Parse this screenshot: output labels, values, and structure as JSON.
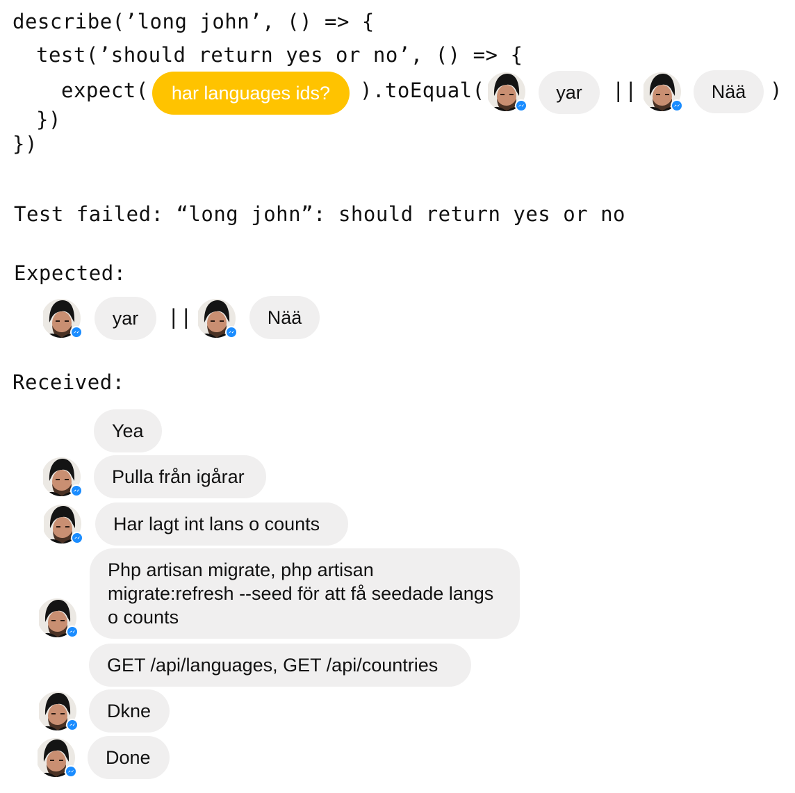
{
  "code": {
    "describe_line": "describe(’long john’, () => {",
    "test_line": "test(’should return yes or no’, () => {",
    "expect_open": "expect(",
    "to_equal": ").toEqual(",
    "or_op": "||",
    "close_paren": ")",
    "close_test": "})",
    "close_describe": "})"
  },
  "expect_bubble": "har languages ids?",
  "expected_values": [
    "yar",
    "Nää"
  ],
  "result": {
    "failure_line": "Test failed: “long john”: should return yes or no",
    "expected_label": "Expected:",
    "received_label": "Received:"
  },
  "received_messages": [
    "Yea",
    "Pulla från igårar",
    "Har lagt int lans o counts",
    "Php artisan migrate, php artisan migrate:refresh --seed för att få seedade langs o counts",
    "GET /api/languages, GET /api/countries",
    "Dkne",
    "Done"
  ],
  "icons": {
    "avatar": "user-avatar",
    "badge": "messenger-badge-icon"
  },
  "colors": {
    "highlight_bubble": "#ffc300",
    "bubble": "#f0efef",
    "badge": "#1a8cff"
  }
}
